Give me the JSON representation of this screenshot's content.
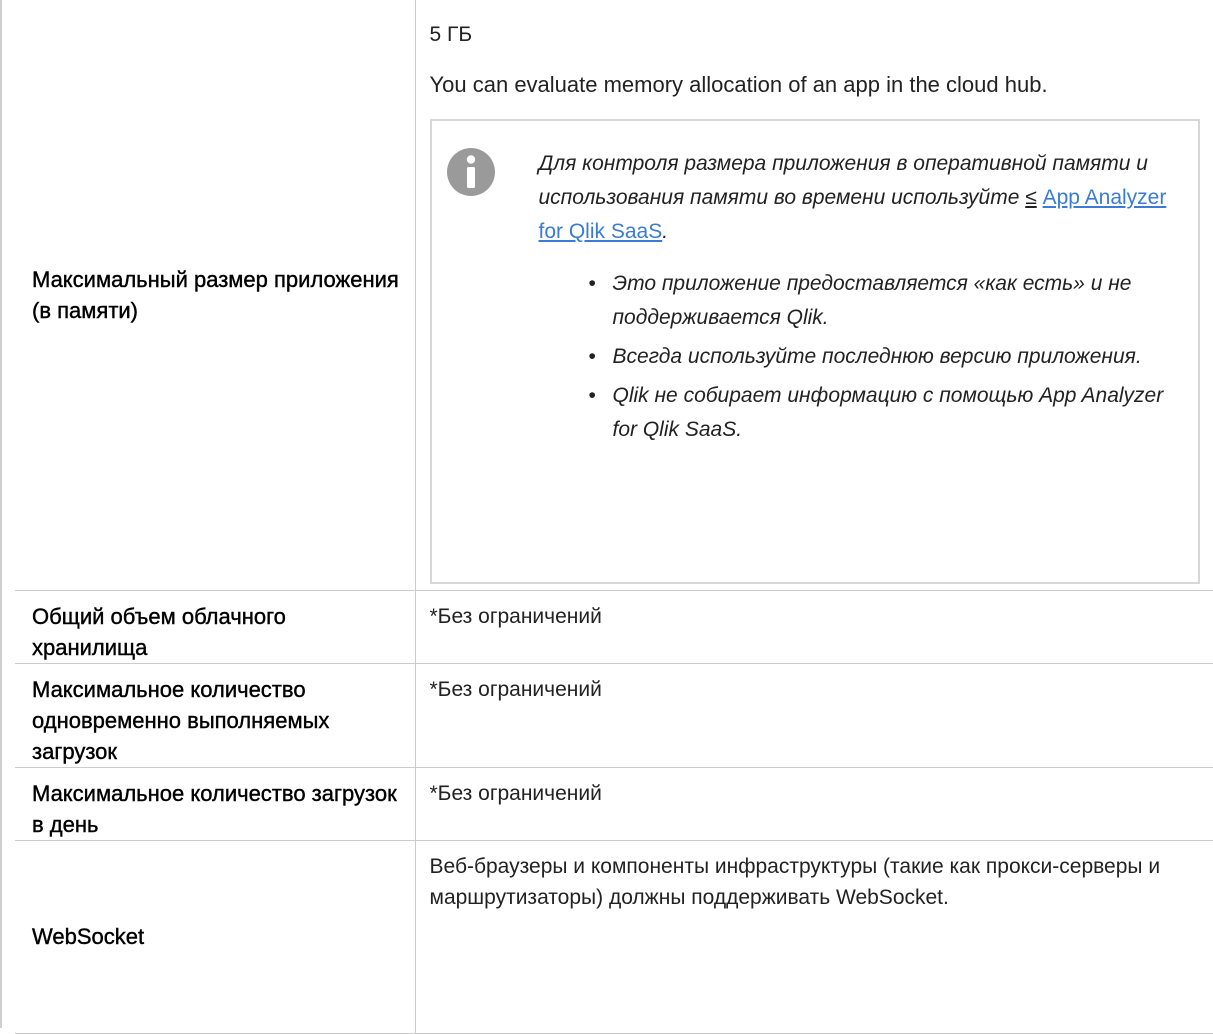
{
  "rows": [
    {
      "label": "Максимальный размер приложения (в памяти)",
      "value_size": "5 ГБ",
      "value_description": "You can evaluate memory allocation of an app in the cloud hub.",
      "note": {
        "icon": "info-icon",
        "text_before_link": "Для контроля размера приложения в оперативной памяти и использования памяти во времени используйте",
        "link_symbol": "≤",
        "link_text": "App Analyzer for Qlik SaaS",
        "text_after_link": ".",
        "bullets": [
          "Это приложение предоставляется «как есть» и не поддерживается Qlik.",
          "Всегда используйте последнюю версию приложения.",
          "Qlik не собирает информацию с помощью App Analyzer for Qlik SaaS."
        ]
      }
    },
    {
      "label": "Общий объем облачного хранилища",
      "value": "*Без ограничений"
    },
    {
      "label": "Максимальное количество одновременно выполняемых загрузок",
      "value": "*Без ограничений"
    },
    {
      "label": "Максимальное количество загрузок в день",
      "value": "*Без ограничений"
    },
    {
      "label": "WebSocket",
      "value": "Веб-браузеры и компоненты инфраструктуры (такие как прокси-серверы и маршрутизаторы) должны поддерживать WebSocket."
    }
  ],
  "colors": {
    "border": "#cccccc",
    "note_border": "#d7d7d7",
    "link": "#3a7bd5",
    "info_icon": "#9a9a9a"
  }
}
